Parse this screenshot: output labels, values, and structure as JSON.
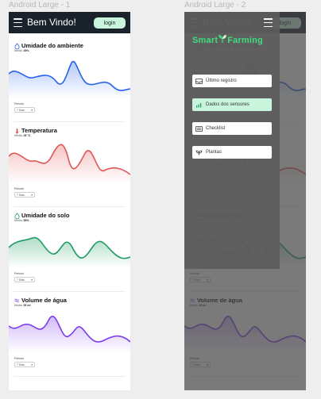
{
  "frames": {
    "left_label": "Android Large - 1",
    "right_label": "Android Large - 2"
  },
  "appbar": {
    "title": "Bem Vindo!",
    "login_label": "login"
  },
  "cards": [
    {
      "title": "Umidade do ambiente",
      "media_label": "Média:",
      "media_value": "25%",
      "period_label": "Periodo",
      "period_value": "7 Dias",
      "color": "#2563eb",
      "icon": "water-drop-icon"
    },
    {
      "title": "Temperatura",
      "media_label": "Média:",
      "media_value": "25 °C",
      "period_label": "Periodo",
      "period_value": "7 Dias",
      "color": "#e25555",
      "icon": "thermometer-icon"
    },
    {
      "title": "Umidade do solo",
      "media_label": "Média:",
      "media_value": "35%",
      "period_label": "Periodo",
      "period_value": "7 Dias",
      "color": "#1f9b62",
      "icon": "soil-drop-icon"
    },
    {
      "title": "Volume de água",
      "media_label": "Média:",
      "media_value": "29 ml",
      "period_label": "Periodo",
      "period_value": "7 Dias",
      "color": "#7c3aed",
      "icon": "water-waves-icon"
    }
  ],
  "drawer": {
    "logo_part1": "Smart",
    "logo_part2": "Farming",
    "items": [
      {
        "label": "Último registro",
        "icon": "inbox-icon",
        "active": false
      },
      {
        "label": "Dados dos sensores",
        "icon": "bar-chart-icon",
        "active": true
      },
      {
        "label": "Checklist",
        "icon": "list-icon",
        "active": false
      },
      {
        "label": "Plantas",
        "icon": "plant-icon",
        "active": false
      }
    ]
  },
  "colors": {
    "appbar": "#1a232c",
    "login_bg": "#c9f5dc",
    "logo_green": "#3fdc7d"
  }
}
